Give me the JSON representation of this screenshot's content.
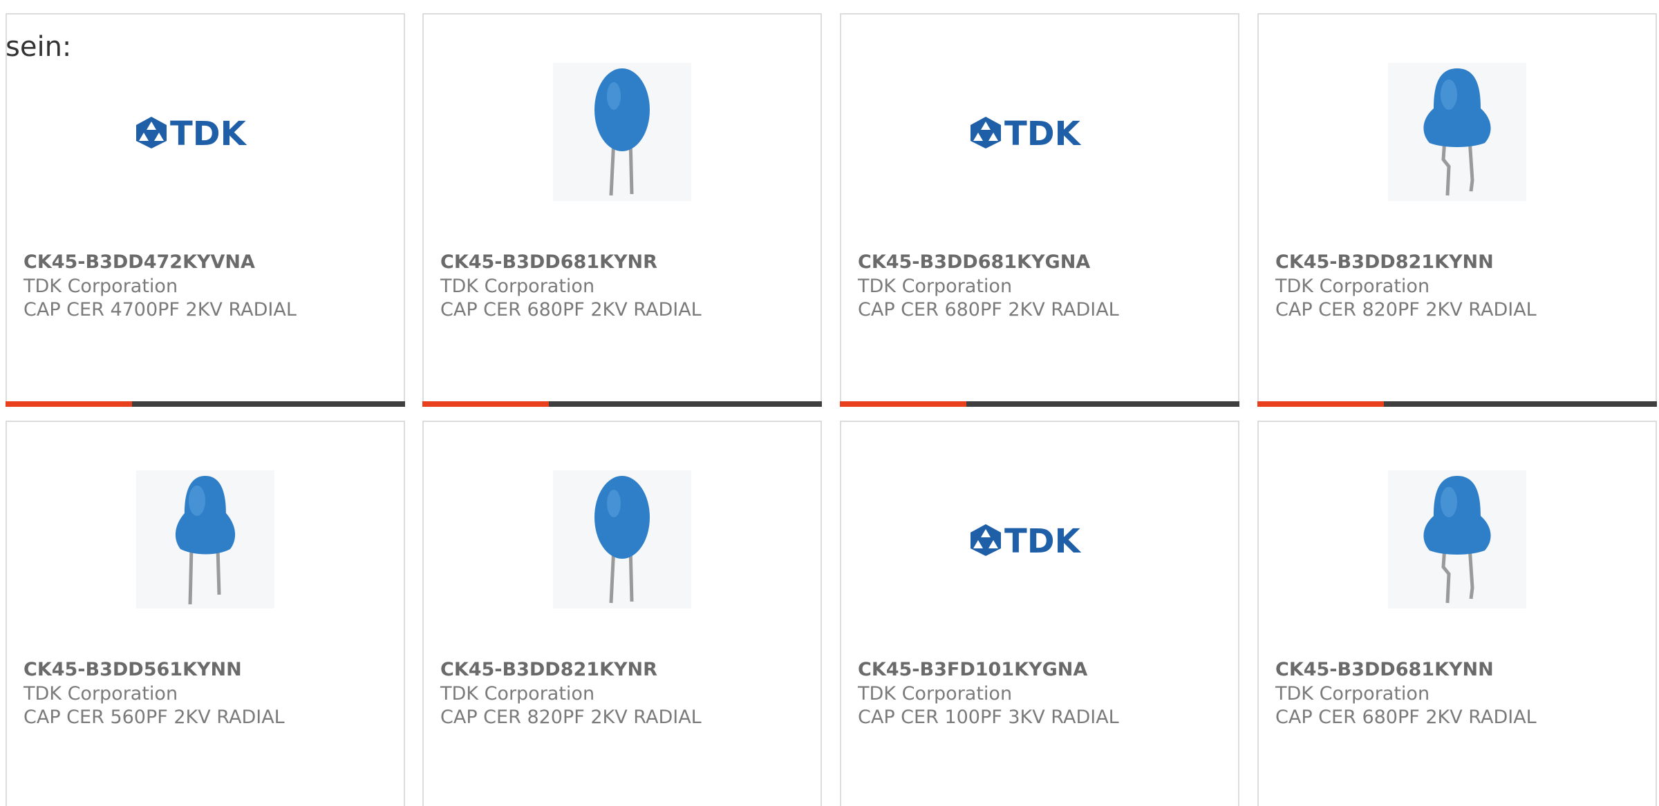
{
  "page": {
    "prefix_text": "sein:"
  },
  "products": [
    {
      "part_number": "CK45-B3DD472KYVNA",
      "manufacturer": "TDK Corporation",
      "description": "CAP CER 4700PF 2KV RADIAL",
      "image": "tdk-logo"
    },
    {
      "part_number": "CK45-B3DD681KYNR",
      "manufacturer": "TDK Corporation",
      "description": "CAP CER 680PF 2KV RADIAL",
      "image": "capacitor-narrow"
    },
    {
      "part_number": "CK45-B3DD681KYGNA",
      "manufacturer": "TDK Corporation",
      "description": "CAP CER 680PF 2KV RADIAL",
      "image": "tdk-logo"
    },
    {
      "part_number": "CK45-B3DD821KYNN",
      "manufacturer": "TDK Corporation",
      "description": "CAP CER 820PF 2KV RADIAL",
      "image": "capacitor-wide"
    },
    {
      "part_number": "CK45-B3DD561KYNN",
      "manufacturer": "TDK Corporation",
      "description": "CAP CER 560PF 2KV RADIAL",
      "image": "capacitor-wide"
    },
    {
      "part_number": "CK45-B3DD821KYNR",
      "manufacturer": "TDK Corporation",
      "description": "CAP CER 820PF 2KV RADIAL",
      "image": "capacitor-narrow"
    },
    {
      "part_number": "CK45-B3FD101KYGNA",
      "manufacturer": "TDK Corporation",
      "description": "CAP CER 100PF 3KV RADIAL",
      "image": "tdk-logo"
    },
    {
      "part_number": "CK45-B3DD681KYNN",
      "manufacturer": "TDK Corporation",
      "description": "CAP CER 680PF 2KV RADIAL",
      "image": "capacitor-wide"
    }
  ],
  "colors": {
    "accent": "#e8401c",
    "bar_dark": "#3f3f3f",
    "tdk_blue": "#1f5fa8",
    "capacitor_blue": "#2f7fc8"
  },
  "brand": {
    "logo_text": "TDK"
  }
}
